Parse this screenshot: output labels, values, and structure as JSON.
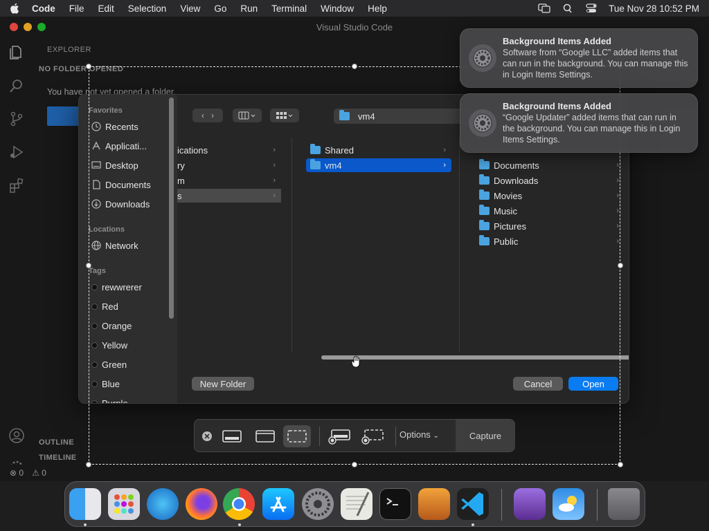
{
  "menubar": {
    "app": "Code",
    "items": [
      "File",
      "Edit",
      "Selection",
      "View",
      "Go",
      "Run",
      "Terminal",
      "Window",
      "Help"
    ],
    "clock": "Tue Nov 28  10:52 PM"
  },
  "vscode": {
    "title": "Visual Studio Code",
    "explorer_header": "EXPLORER",
    "no_folder": "NO FOLDER OPENED",
    "no_folder_msg": "You have not yet opened a folder.",
    "outline": "OUTLINE",
    "timeline": "TIMELINE",
    "status_errors": "0",
    "status_warnings": "0"
  },
  "dialog": {
    "sidebar": {
      "favorites_label": "Favorites",
      "favorites": [
        "Recents",
        "Applicati...",
        "Desktop",
        "Documents",
        "Downloads"
      ],
      "locations_label": "Locations",
      "locations": [
        "Network"
      ],
      "tags_label": "Tags",
      "tags": [
        "rewwrerer",
        "Red",
        "Orange",
        "Yellow",
        "Green",
        "Blue",
        "Purple"
      ]
    },
    "path": "vm4",
    "col1": [
      "ications",
      "ry",
      "m",
      "s"
    ],
    "col2": [
      "Shared",
      "vm4"
    ],
    "col3": [
      "Documents",
      "Downloads",
      "Movies",
      "Music",
      "Pictures",
      "Public"
    ],
    "new_folder": "New Folder",
    "cancel": "Cancel",
    "open": "Open"
  },
  "notifications": [
    {
      "title": "Background Items Added",
      "body": "Software from “Google LLC” added items that can run in the background. You can manage this in Login Items Settings."
    },
    {
      "title": "Background Items Added",
      "body": "“Google Updater” added items that can run in the background. You can manage this in Login Items Settings."
    }
  ],
  "shotbar": {
    "options": "Options",
    "capture": "Capture"
  },
  "colors": {
    "accent": "#0a7cf2",
    "selection": "#0a58ca",
    "folder": "#4aa3df"
  }
}
